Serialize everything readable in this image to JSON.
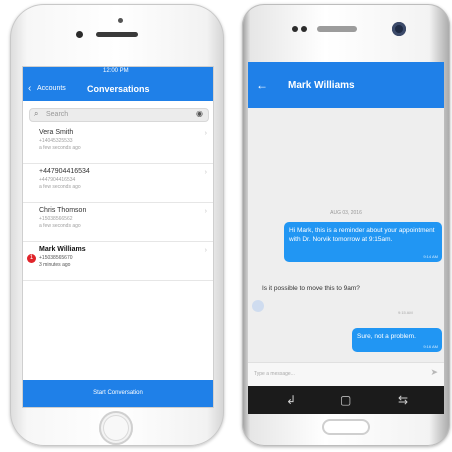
{
  "iphone": {
    "status": {
      "time": "12:00 PM"
    },
    "nav": {
      "back_icon": "chevron-left-icon",
      "back_label": "Accounts",
      "title": "Conversations"
    },
    "search": {
      "placeholder": "Search",
      "icon": "search-icon",
      "eye_icon": "eye-icon"
    },
    "conversations": [
      {
        "name": "Vera Smith",
        "phone": "+14045325533",
        "time": "a few seconds ago",
        "unread": ""
      },
      {
        "name": "+447904416534",
        "phone": "+447904416534",
        "time": "a few seconds ago",
        "unread": ""
      },
      {
        "name": "Chris Thomson",
        "phone": "+15038566562",
        "time": "a few seconds ago",
        "unread": ""
      },
      {
        "name": "Mark Williams",
        "phone": "+15038565670",
        "time": "3 minutes ago",
        "unread": "1"
      }
    ],
    "bottom_button": "Start Conversation"
  },
  "android": {
    "header": {
      "back_icon": "arrow-left-icon",
      "title": "Mark Williams"
    },
    "date_label": "AUG 03, 2016",
    "messages": [
      {
        "direction": "out",
        "text": "Hi Mark, this is a reminder about your appointment with Dr. Norvik tomorrow at 9:15am.",
        "time": "9:14 AM"
      },
      {
        "direction": "in",
        "text": "Is it possible to move this to 9am?",
        "time": "9:15 AM"
      },
      {
        "direction": "out",
        "text": "Sure, not a problem.",
        "time": "9:16 AM"
      }
    ],
    "input_placeholder": "Type a message...",
    "send_icon": "send-icon",
    "nav_icons": [
      "back-key-icon",
      "home-key-icon",
      "recents-key-icon"
    ]
  },
  "colors": {
    "primary_blue": "#1f80e8",
    "bubble_blue": "#2196f3",
    "badge_red": "#e0242a"
  }
}
